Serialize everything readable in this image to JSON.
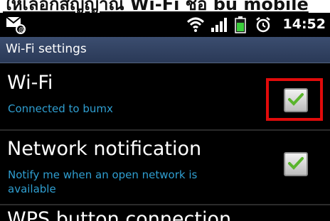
{
  "caption": {
    "text": "ให้เลือกสัญญาณ Wi-Fi ชื่อ bu mobile"
  },
  "status_bar": {
    "time": "14:52",
    "icons": [
      "notification-icon",
      "wifi-signal-icon",
      "cell-signal-icon",
      "battery-icon",
      "alarm-icon"
    ]
  },
  "title_bar": {
    "title": "Wi-Fi settings",
    "color": "#2f3f60"
  },
  "settings": [
    {
      "title": "Wi-Fi",
      "subtitle": "Connected to bumx",
      "checked": true
    },
    {
      "title": "Network notification",
      "subtitle_lines": [
        "Notify me when an open network is",
        "available"
      ],
      "checked": true
    },
    {
      "title": "WPS button connection"
    }
  ],
  "colors": {
    "accent": "#2f9ed0",
    "highlight": "#e10b0b",
    "check": "#5ab52c"
  }
}
